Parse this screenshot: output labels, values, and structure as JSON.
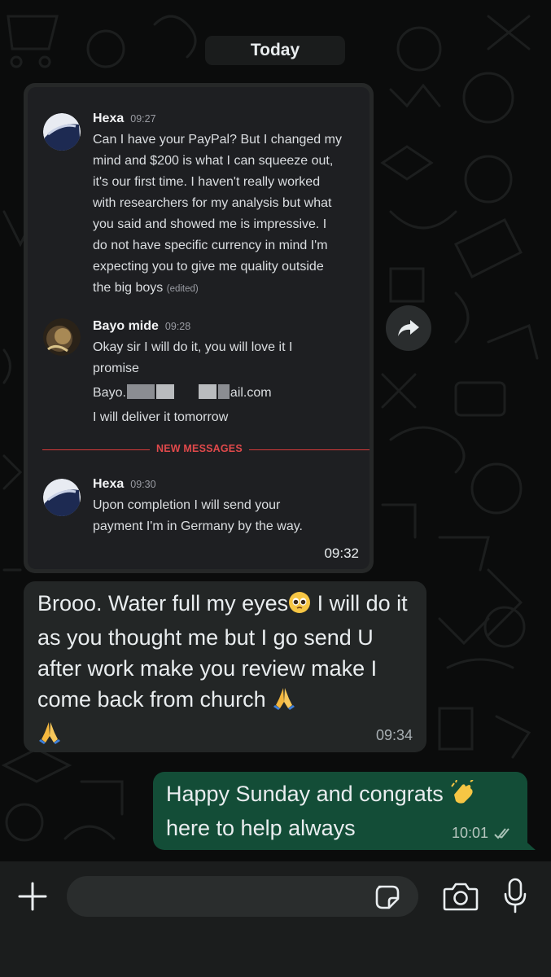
{
  "date_chip": "Today",
  "forwarded_screenshot": {
    "messages": [
      {
        "author": "Hexa",
        "time": "09:27",
        "lines": [
          "Can I have your PayPal? But I changed my",
          "mind and $200 is what I can squeeze out,",
          "it's our first time. I haven't really worked",
          "with researchers for my analysis but what",
          "you said and showed me is impressive. I",
          "do not  have specific currency in mind I'm",
          "expecting you to give me quality outside",
          "the big boys"
        ],
        "edited_label": "(edited)"
      },
      {
        "author": "Bayo mide",
        "time": "09:28",
        "lines": [
          "Okay sir I will do it, you will love it I",
          "promise"
        ],
        "email_prefix": "Bayo.",
        "email_suffix": "ail.com",
        "last_line": "I will deliver it tomorrow"
      },
      {
        "author": "Hexa",
        "time": "09:30",
        "lines": [
          "Upon completion I will send your",
          "payment I'm in Germany by the way."
        ]
      }
    ],
    "divider_label": "NEW MESSAGES",
    "bubble_time": "09:32"
  },
  "incoming_message": {
    "text_part1": "Brooo. Water full my eyes",
    "text_part2": " I will do it as you thought me but I go send U after work make you review make I come back from church ",
    "time": "09:34"
  },
  "outgoing_message": {
    "text_part1": "Happy Sunday and congrats ",
    "text_part2": "here to help always",
    "time": "10:01",
    "status": "read"
  },
  "icons": [
    "plus-icon",
    "sticker-icon",
    "camera-icon",
    "microphone-icon",
    "forward-icon",
    "double-check-icon"
  ],
  "colors": {
    "outgoing_bubble": "#134d37",
    "incoming_bubble": "#232626",
    "background": "#0b0c0c",
    "divider_red": "#d83b3b"
  }
}
